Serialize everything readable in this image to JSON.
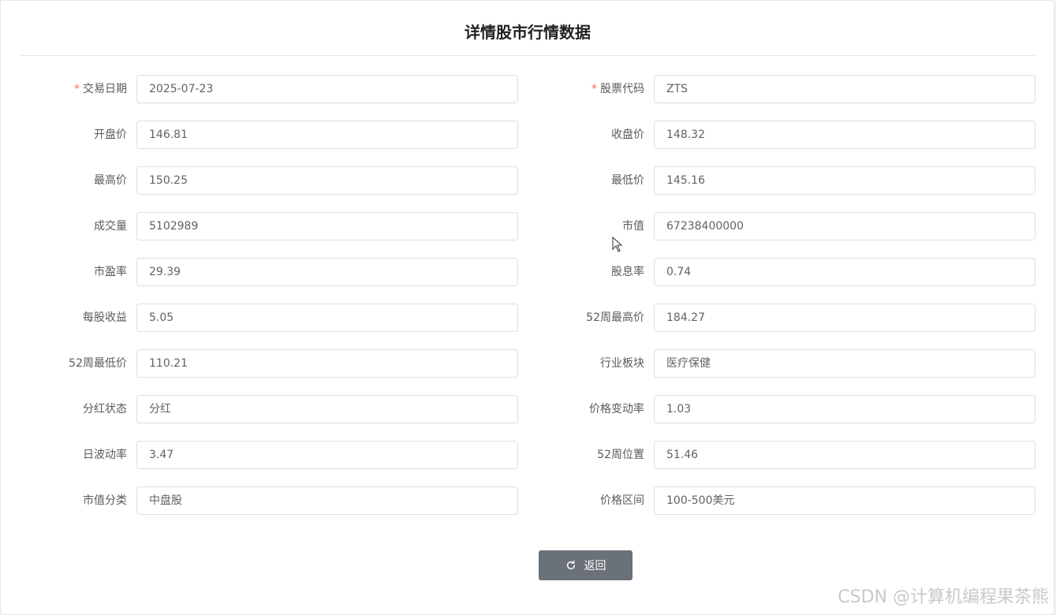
{
  "dialog": {
    "title": "详情股市行情数据",
    "back_label": "返回"
  },
  "fields_left": [
    {
      "label": "交易日期",
      "value": "2025-07-23",
      "required": true
    },
    {
      "label": "开盘价",
      "value": "146.81",
      "required": false
    },
    {
      "label": "最高价",
      "value": "150.25",
      "required": false
    },
    {
      "label": "成交量",
      "value": "5102989",
      "required": false
    },
    {
      "label": "市盈率",
      "value": "29.39",
      "required": false
    },
    {
      "label": "每股收益",
      "value": "5.05",
      "required": false
    },
    {
      "label": "52周最低价",
      "value": "110.21",
      "required": false
    },
    {
      "label": "分红状态",
      "value": "分红",
      "required": false
    },
    {
      "label": "日波动率",
      "value": "3.47",
      "required": false
    },
    {
      "label": "市值分类",
      "value": "中盘股",
      "required": false
    }
  ],
  "fields_right": [
    {
      "label": "股票代码",
      "value": "ZTS",
      "required": true
    },
    {
      "label": "收盘价",
      "value": "148.32",
      "required": false
    },
    {
      "label": "最低价",
      "value": "145.16",
      "required": false
    },
    {
      "label": "市值",
      "value": "67238400000",
      "required": false
    },
    {
      "label": "股息率",
      "value": "0.74",
      "required": false
    },
    {
      "label": "52周最高价",
      "value": "184.27",
      "required": false
    },
    {
      "label": "行业板块",
      "value": "医疗保健",
      "required": false
    },
    {
      "label": "价格变动率",
      "value": "1.03",
      "required": false
    },
    {
      "label": "52周位置",
      "value": "51.46",
      "required": false
    },
    {
      "label": "价格区间",
      "value": "100-500美元",
      "required": false
    }
  ],
  "required_mark": "*",
  "watermark": "CSDN @计算机编程果茶熊",
  "icons": {
    "back": "refresh-icon",
    "cursor": "mouse-pointer-icon"
  }
}
